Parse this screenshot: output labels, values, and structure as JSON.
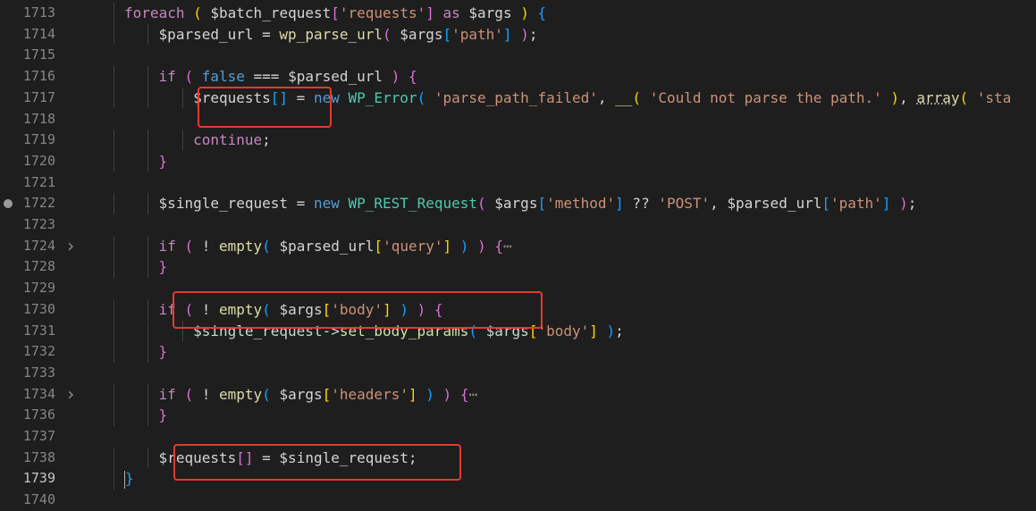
{
  "editor": {
    "lines": [
      {
        "num": "1713",
        "indent": 2,
        "tokens": [
          [
            "kw",
            "foreach"
          ],
          [
            "op",
            " "
          ],
          [
            "b1",
            "("
          ],
          [
            "op",
            " "
          ],
          [
            "var-plain",
            "$batch_request"
          ],
          [
            "b2",
            "["
          ],
          [
            "str",
            "'requests'"
          ],
          [
            "b2",
            "]"
          ],
          [
            "op",
            " "
          ],
          [
            "kw",
            "as"
          ],
          [
            "op",
            " "
          ],
          [
            "var-plain",
            "$args"
          ],
          [
            "op",
            " "
          ],
          [
            "b1",
            ")"
          ],
          [
            "op",
            " "
          ],
          [
            "b3",
            "{"
          ]
        ]
      },
      {
        "num": "1714",
        "indent": 3,
        "tokens": [
          [
            "var-plain",
            "$parsed_url"
          ],
          [
            "op",
            " = "
          ],
          [
            "fn",
            "wp_parse_url"
          ],
          [
            "b2",
            "("
          ],
          [
            "op",
            " "
          ],
          [
            "var-plain",
            "$args"
          ],
          [
            "b3",
            "["
          ],
          [
            "str",
            "'path'"
          ],
          [
            "b3",
            "]"
          ],
          [
            "op",
            " "
          ],
          [
            "b2",
            ")"
          ],
          [
            "op",
            ";"
          ]
        ]
      },
      {
        "num": "1715",
        "indent": 0,
        "tokens": []
      },
      {
        "num": "1716",
        "indent": 3,
        "tokens": [
          [
            "kw",
            "if"
          ],
          [
            "op",
            " "
          ],
          [
            "b2",
            "("
          ],
          [
            "op",
            " "
          ],
          [
            "kb",
            "false"
          ],
          [
            "op",
            " === "
          ],
          [
            "var-plain",
            "$parsed_url"
          ],
          [
            "op",
            " "
          ],
          [
            "b2",
            ")"
          ],
          [
            "op",
            " "
          ],
          [
            "b2",
            "{"
          ]
        ]
      },
      {
        "num": "1717",
        "indent": 4,
        "tokens": [
          [
            "var-plain",
            "$requests"
          ],
          [
            "b3",
            "[]"
          ],
          [
            "op",
            " = "
          ],
          [
            "kb",
            "new"
          ],
          [
            "op",
            " "
          ],
          [
            "cls",
            "WP_Error"
          ],
          [
            "b3",
            "("
          ],
          [
            "op",
            " "
          ],
          [
            "str",
            "'parse_path_failed'"
          ],
          [
            "op",
            ", "
          ],
          [
            "fn",
            "__"
          ],
          [
            "b1",
            "("
          ],
          [
            "op",
            " "
          ],
          [
            "str",
            "'Could not parse the path.'"
          ],
          [
            "op",
            " "
          ],
          [
            "b1",
            ")"
          ],
          [
            "op",
            ", "
          ],
          [
            "fn dec",
            "array"
          ],
          [
            "b1",
            "("
          ],
          [
            "op",
            " "
          ],
          [
            "str",
            "'sta"
          ]
        ]
      },
      {
        "num": "1718",
        "indent": 0,
        "tokens": []
      },
      {
        "num": "1719",
        "indent": 4,
        "tokens": [
          [
            "kw",
            "continue"
          ],
          [
            "op",
            ";"
          ]
        ]
      },
      {
        "num": "1720",
        "indent": 3,
        "tokens": [
          [
            "b2",
            "}"
          ]
        ]
      },
      {
        "num": "1721",
        "indent": 0,
        "tokens": []
      },
      {
        "num": "1722",
        "indent": 3,
        "breakpoint": true,
        "tokens": [
          [
            "var-plain",
            "$single_request"
          ],
          [
            "op",
            " = "
          ],
          [
            "kb",
            "new"
          ],
          [
            "op",
            " "
          ],
          [
            "cls",
            "WP_REST_Request"
          ],
          [
            "b2",
            "("
          ],
          [
            "op",
            " "
          ],
          [
            "var-plain",
            "$args"
          ],
          [
            "b3",
            "["
          ],
          [
            "str",
            "'method'"
          ],
          [
            "b3",
            "]"
          ],
          [
            "op",
            " ?? "
          ],
          [
            "str",
            "'POST'"
          ],
          [
            "op",
            ", "
          ],
          [
            "var-plain",
            "$parsed_url"
          ],
          [
            "b3",
            "["
          ],
          [
            "str",
            "'path'"
          ],
          [
            "b3",
            "]"
          ],
          [
            "op",
            " "
          ],
          [
            "b2",
            ")"
          ],
          [
            "op",
            ";"
          ]
        ]
      },
      {
        "num": "1723",
        "indent": 0,
        "tokens": []
      },
      {
        "num": "1724",
        "indent": 3,
        "folded": true,
        "tokens": [
          [
            "kw",
            "if"
          ],
          [
            "op",
            " "
          ],
          [
            "b2",
            "("
          ],
          [
            "op",
            " ! "
          ],
          [
            "fn",
            "empty"
          ],
          [
            "b3",
            "("
          ],
          [
            "op",
            " "
          ],
          [
            "var-plain",
            "$parsed_url"
          ],
          [
            "b1",
            "["
          ],
          [
            "str",
            "'query'"
          ],
          [
            "b1",
            "]"
          ],
          [
            "op",
            " "
          ],
          [
            "b3",
            ")"
          ],
          [
            "op",
            " "
          ],
          [
            "b2",
            ")"
          ],
          [
            "op",
            " "
          ],
          [
            "b2",
            "{"
          ],
          [
            "ell",
            "⋯"
          ]
        ]
      },
      {
        "num": "1728",
        "indent": 3,
        "tokens": [
          [
            "b2",
            "}"
          ]
        ]
      },
      {
        "num": "1729",
        "indent": 0,
        "tokens": []
      },
      {
        "num": "1730",
        "indent": 3,
        "tokens": [
          [
            "kw",
            "if"
          ],
          [
            "op",
            " "
          ],
          [
            "b2",
            "("
          ],
          [
            "op",
            " ! "
          ],
          [
            "fn",
            "empty"
          ],
          [
            "b3",
            "("
          ],
          [
            "op",
            " "
          ],
          [
            "var-plain",
            "$args"
          ],
          [
            "b1",
            "["
          ],
          [
            "str",
            "'body'"
          ],
          [
            "b1",
            "]"
          ],
          [
            "op",
            " "
          ],
          [
            "b3",
            ")"
          ],
          [
            "op",
            " "
          ],
          [
            "b2",
            ")"
          ],
          [
            "op",
            " "
          ],
          [
            "b2",
            "{"
          ]
        ]
      },
      {
        "num": "1731",
        "indent": 4,
        "tokens": [
          [
            "var-plain",
            "$single_request"
          ],
          [
            "op",
            "->"
          ],
          [
            "fn",
            "set_body_params"
          ],
          [
            "b3",
            "("
          ],
          [
            "op",
            " "
          ],
          [
            "var-plain",
            "$args"
          ],
          [
            "b1",
            "["
          ],
          [
            "str",
            "'body'"
          ],
          [
            "b1",
            "]"
          ],
          [
            "op",
            " "
          ],
          [
            "b3",
            ")"
          ],
          [
            "op",
            ";"
          ]
        ]
      },
      {
        "num": "1732",
        "indent": 3,
        "tokens": [
          [
            "b2",
            "}"
          ]
        ]
      },
      {
        "num": "1733",
        "indent": 0,
        "tokens": []
      },
      {
        "num": "1734",
        "indent": 3,
        "folded": true,
        "tokens": [
          [
            "kw",
            "if"
          ],
          [
            "op",
            " "
          ],
          [
            "b2",
            "("
          ],
          [
            "op",
            " ! "
          ],
          [
            "fn",
            "empty"
          ],
          [
            "b3",
            "("
          ],
          [
            "op",
            " "
          ],
          [
            "var-plain",
            "$args"
          ],
          [
            "b1",
            "["
          ],
          [
            "str",
            "'headers'"
          ],
          [
            "b1",
            "]"
          ],
          [
            "op",
            " "
          ],
          [
            "b3",
            ")"
          ],
          [
            "op",
            " "
          ],
          [
            "b2",
            ")"
          ],
          [
            "op",
            " "
          ],
          [
            "b2",
            "{"
          ],
          [
            "ell",
            "⋯"
          ]
        ]
      },
      {
        "num": "1736",
        "indent": 3,
        "tokens": [
          [
            "b2",
            "}"
          ]
        ]
      },
      {
        "num": "1737",
        "indent": 0,
        "tokens": []
      },
      {
        "num": "1738",
        "indent": 3,
        "tokens": [
          [
            "var-plain",
            "$requests"
          ],
          [
            "b2",
            "[]"
          ],
          [
            "op",
            " = "
          ],
          [
            "var-plain",
            "$single_request"
          ],
          [
            "op",
            ";"
          ]
        ]
      },
      {
        "num": "1739",
        "indent": 2,
        "current": true,
        "tokens": [
          [
            "b3",
            "}"
          ]
        ]
      },
      {
        "num": "1740",
        "indent": 0,
        "tokens": []
      }
    ]
  },
  "colors": {
    "background": "#1e1e1e",
    "highlight_box": "#e53a2c"
  }
}
